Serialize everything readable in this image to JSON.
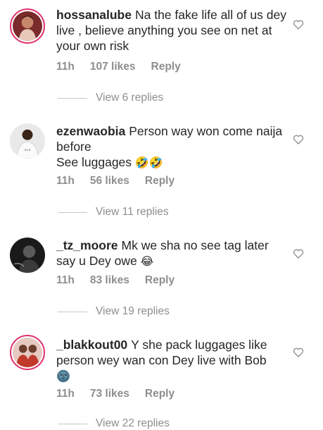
{
  "comments": [
    {
      "username": "hossanalube",
      "text": "Na the fake life all of us dey live , believe anything you see on net at your own risk",
      "emoji": "",
      "time": "11h",
      "likes": "107 likes",
      "reply": "Reply",
      "view_replies": "View 6 replies"
    },
    {
      "username": "ezenwaobia",
      "text": "Person way won come naija before",
      "text2": "See luggages",
      "emoji": "🤣🤣",
      "time": "11h",
      "likes": "56 likes",
      "reply": "Reply",
      "view_replies": "View 11 replies"
    },
    {
      "username": "_tz_moore",
      "text": "Mk we sha no see tag later say u Dey owe",
      "emoji": "😂",
      "time": "11h",
      "likes": "83 likes",
      "reply": "Reply",
      "view_replies": "View 19 replies"
    },
    {
      "username": "_blakkout00",
      "text": "Y she pack luggages like person wey wan con Dey live with Bob",
      "emoji": "🌚",
      "time": "11h",
      "likes": "73 likes",
      "reply": "Reply",
      "view_replies": "View 22 replies"
    }
  ],
  "icons": {
    "like": "heart-outline-icon"
  },
  "colors": {
    "story_ring": "#e1306c",
    "meta_text": "#8e8e8e"
  }
}
